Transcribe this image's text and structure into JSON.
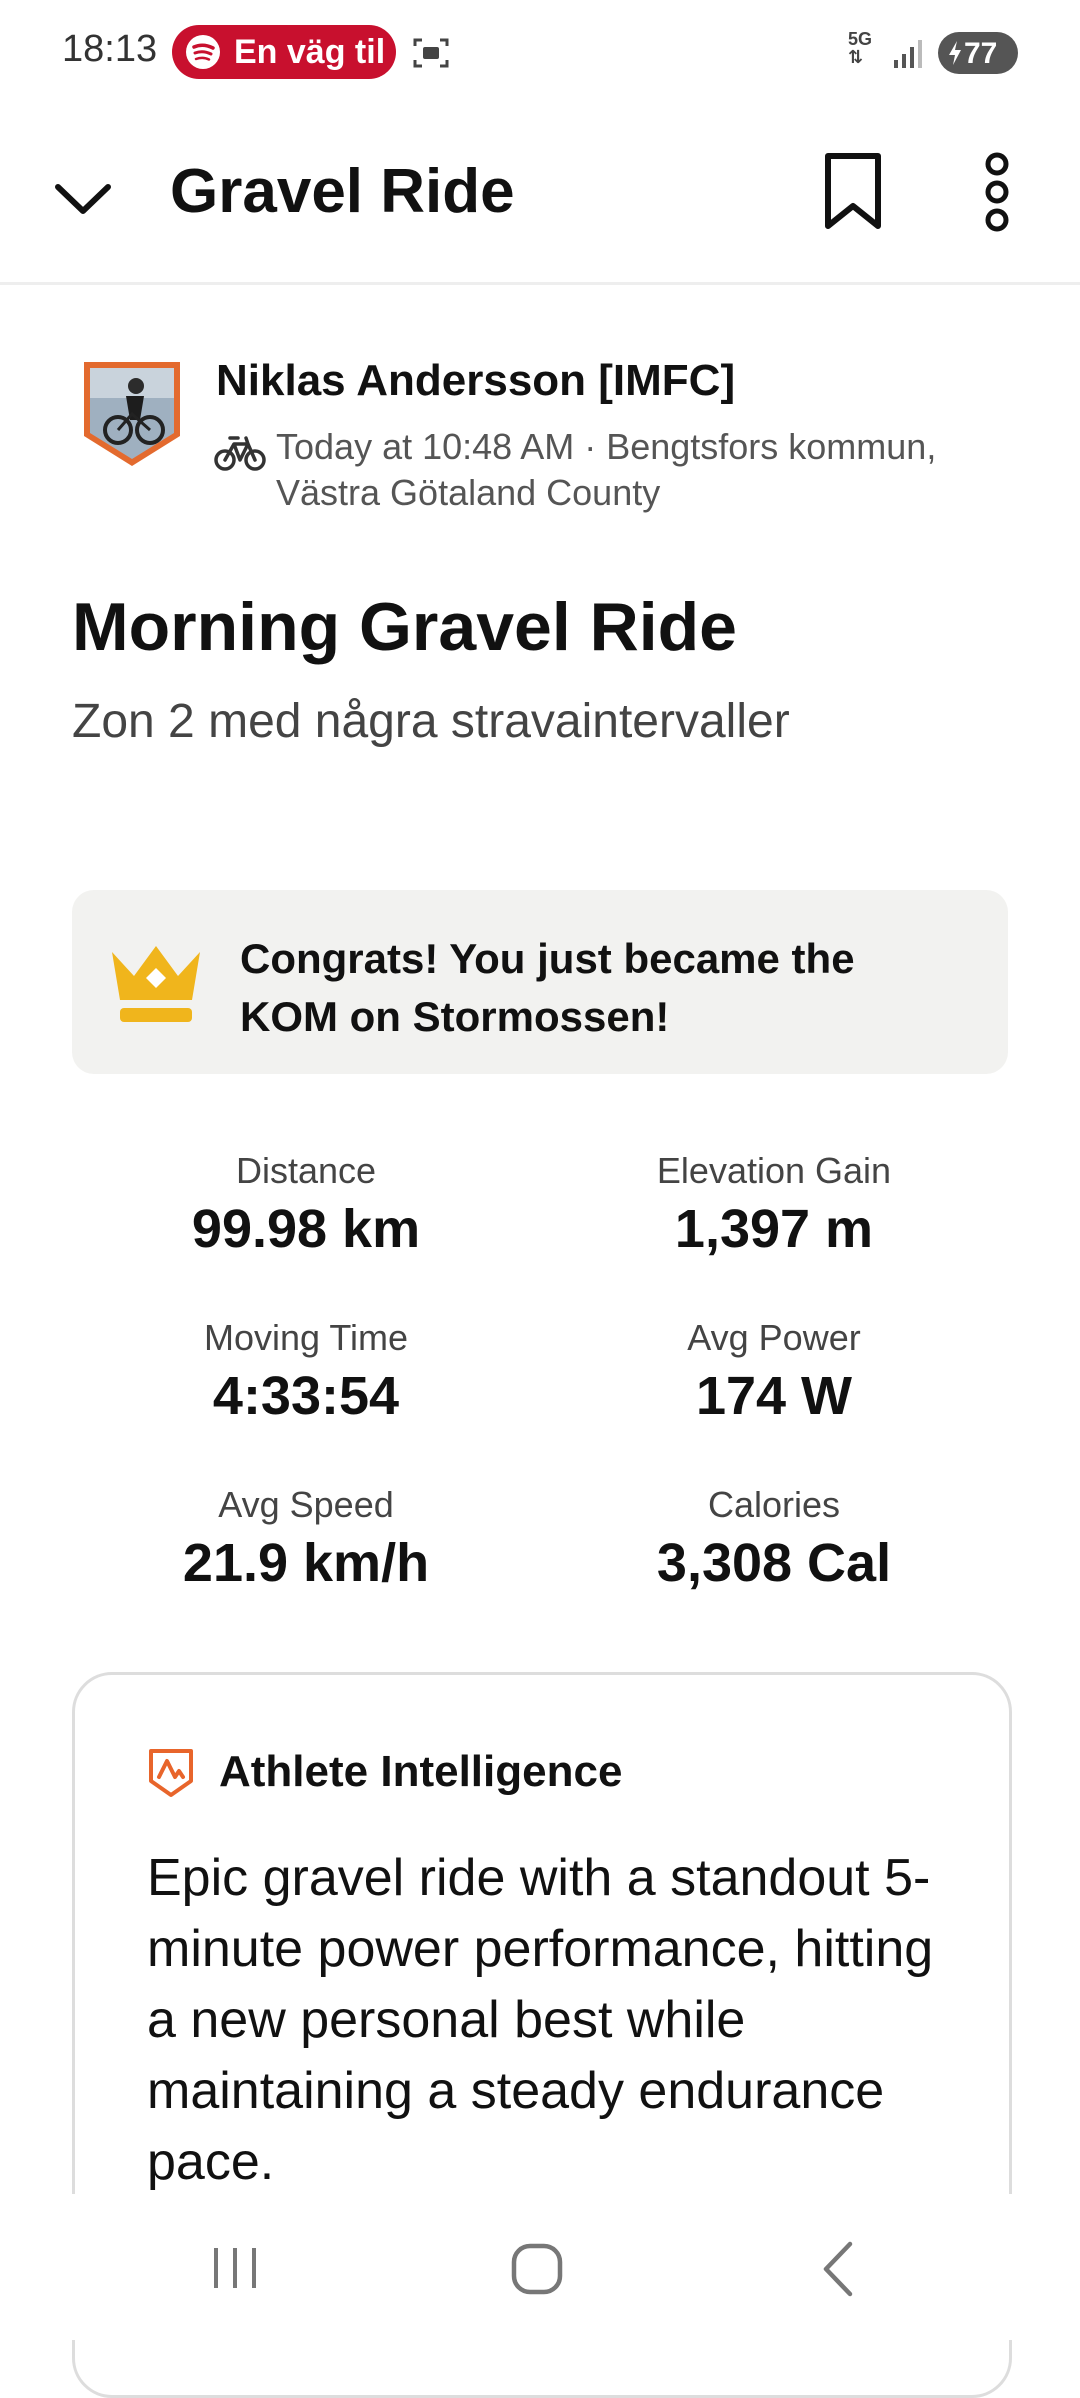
{
  "status_bar": {
    "time": "18:13",
    "media_text": "En väg til",
    "network": "5G",
    "battery": "77",
    "accent": "#c8102e"
  },
  "header": {
    "title": "Gravel Ride",
    "icons": [
      "chevron-down-icon",
      "bookmark-icon",
      "more-vertical-icon"
    ]
  },
  "athlete": {
    "name": "Niklas Andersson [IMFC]",
    "meta": "Today at 10:48 AM · Bengtsfors kommun, Västra Götaland County",
    "activity_icon": "bike-icon"
  },
  "activity": {
    "title": "Morning Gravel Ride",
    "description": "Zon 2 med några stravaintervaller"
  },
  "achievement": {
    "icon": "crown-icon",
    "message": "Congrats! You just became the KOM on Stormossen!",
    "crown_color": "#f0b51c"
  },
  "stats": [
    {
      "label": "Distance",
      "value": "99.98 km"
    },
    {
      "label": "Elevation Gain",
      "value": "1,397 m"
    },
    {
      "label": "Moving Time",
      "value": "4:33:54"
    },
    {
      "label": "Avg Power",
      "value": "174 W"
    },
    {
      "label": "Avg Speed",
      "value": "21.9 km/h"
    },
    {
      "label": "Calories",
      "value": "3,308 Cal"
    }
  ],
  "athlete_intelligence": {
    "title": "Athlete Intelligence",
    "text": "Epic gravel ride with a standout 5-minute power performance, hitting a new personal best while maintaining a steady endurance pace.",
    "icon_color": "#e8652b"
  },
  "nav_bar": {
    "icons": [
      "recents-icon",
      "home-icon",
      "back-icon"
    ]
  }
}
